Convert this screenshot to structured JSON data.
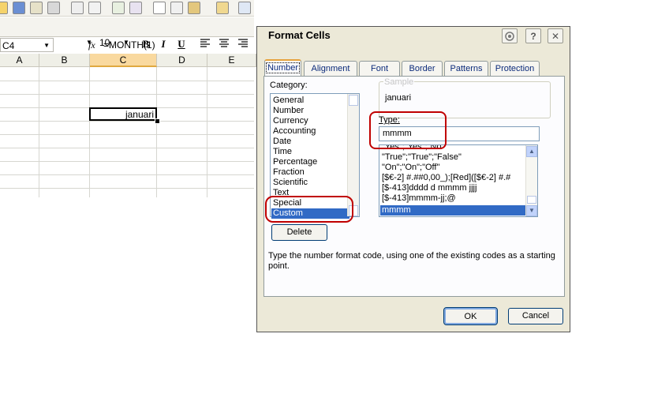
{
  "excel": {
    "font_size": "10",
    "bold_label": "B",
    "italic_label": "I",
    "underline_label": "U",
    "name_box": "C4",
    "fx_label": "fx",
    "formula": "=MONTH(1)",
    "columns": [
      "A",
      "B",
      "C",
      "D",
      "E"
    ],
    "active_column": "C",
    "active_cell_value": "januari"
  },
  "dialog": {
    "title": "Format Cells",
    "help_button": "?",
    "close_button": "✕",
    "tabs": [
      "Number",
      "Alignment",
      "Font",
      "Border",
      "Patterns",
      "Protection"
    ],
    "selected_tab": "Number",
    "category_label": "Category:",
    "categories": [
      "General",
      "Number",
      "Currency",
      "Accounting",
      "Date",
      "Time",
      "Percentage",
      "Fraction",
      "Scientific",
      "Text",
      "Special",
      "Custom"
    ],
    "selected_category": "Custom",
    "sample_legend": "Sample",
    "sample_value": "januari",
    "type_label": "Type:",
    "type_value": "mmmm",
    "type_list": [
      "\"Yes\";\"Yes\";\"No\"",
      "\"True\";\"True\";\"False\"",
      "\"On\";\"On\";\"Off\"",
      "[$€-2] #.##0,00_);[Red]([$€-2] #.#",
      "[$-413]dddd d mmmm jjjj",
      "[$-413]mmmm-jj;@",
      "mmmm"
    ],
    "selected_type": "mmmm",
    "delete_button": "Delete",
    "description": "Type the number format code, using one of the existing codes as a starting point.",
    "ok_button": "OK",
    "cancel_button": "Cancel"
  },
  "colors": {
    "selection": "#316ac5",
    "annotation": "#c00000",
    "dialog_bg": "#ece9d8",
    "active_header": "#f9d99f"
  }
}
